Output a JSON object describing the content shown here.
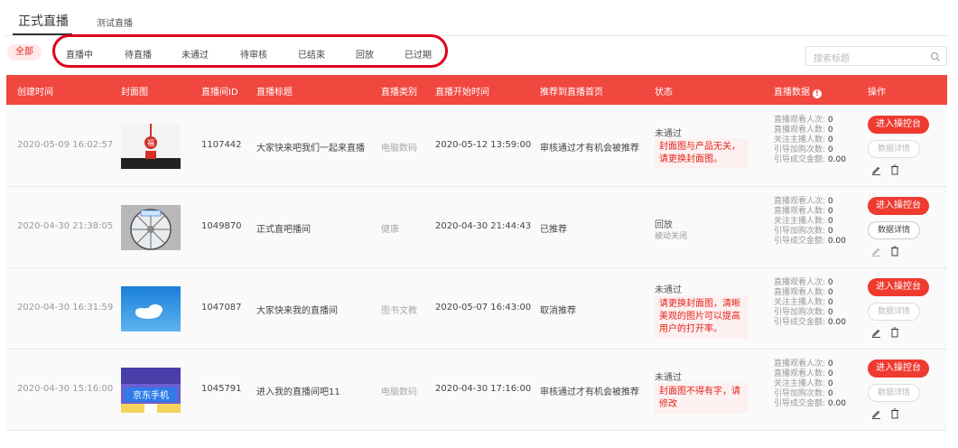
{
  "tabs": {
    "main": "正式直播",
    "test": "测试直播"
  },
  "filters": {
    "all": "全部",
    "items": [
      "直播中",
      "待直播",
      "未通过",
      "待审核",
      "已结束",
      "回放",
      "已过期"
    ]
  },
  "search": {
    "placeholder": "搜索标题"
  },
  "table": {
    "headers": [
      "创建时间",
      "封面图",
      "直播间ID",
      "直播标题",
      "直播类别",
      "直播开始时间",
      "推荐到直播首页",
      "状态",
      "直播数据",
      "操作"
    ],
    "stat_labels": [
      "直播观看人次:",
      "直播观看人数:",
      "关注主播人数:",
      "引导加购次数:",
      "引导成交金额:"
    ],
    "console_label": "进入操控台",
    "data_label": "数据详情",
    "rows": [
      {
        "created": "2020-05-09 16:02:57",
        "id": "1107442",
        "title": "大家快来吧我们一起来直播",
        "category": "电脑数码",
        "start": "2020-05-12 13:59:00",
        "recommend": "审核通过才有机会被推荐",
        "status": "未通过",
        "status_sub": "",
        "reason": "封面图与产品无关，请更换封面图。",
        "stats": [
          "0",
          "0",
          "0",
          "0",
          "0.00"
        ],
        "data_enabled": false
      },
      {
        "created": "2020-04-30 21:38:05",
        "id": "1049870",
        "title": "正式直吧播间",
        "category": "健康",
        "start": "2020-04-30 21:44:43",
        "recommend": "已推荐",
        "status": "回放",
        "status_sub": "被动关闭",
        "reason": "",
        "stats": [
          "0",
          "0",
          "0",
          "0",
          "0.00"
        ],
        "data_enabled": true
      },
      {
        "created": "2020-04-30 16:31:59",
        "id": "1047087",
        "title": "大家快来我的直播间",
        "category": "图书文教",
        "start": "2020-05-07 16:43:00",
        "recommend": "取消推荐",
        "status": "未通过",
        "status_sub": "",
        "reason": "请更换封面图，清晰美观的图片可以提高用户的打开率。",
        "stats": [
          "0",
          "0",
          "0",
          "0",
          "0.00"
        ],
        "data_enabled": false
      },
      {
        "created": "2020-04-30 15:16:00",
        "id": "1045791",
        "title": "进入我的直播间吧11",
        "category": "电脑数码",
        "start": "2020-04-30 17:16:00",
        "recommend": "审核通过才有机会被推荐",
        "status": "未通过",
        "status_sub": "",
        "reason": "封面图不得有字，请修改",
        "stats": [
          "0",
          "0",
          "0",
          "0",
          "0.00"
        ],
        "data_enabled": false
      }
    ]
  },
  "covers": {
    "row_1": {
      "sign_text": "福"
    },
    "row_4": {
      "banner_text": "京东手机"
    }
  },
  "colors": {
    "accent": "#ef3a2f",
    "header_bg": "#f0473f",
    "annotation": "#e0001b"
  }
}
